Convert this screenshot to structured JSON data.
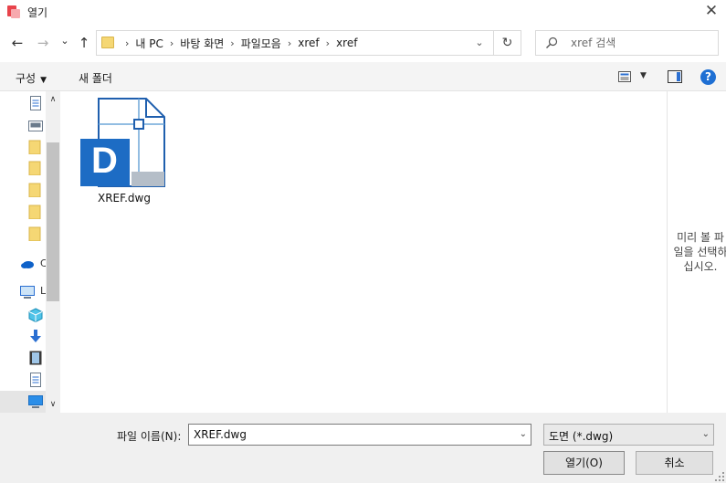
{
  "window": {
    "title": "열기",
    "close_glyph": "✕"
  },
  "nav": {
    "back_glyph": "←",
    "forward_glyph": "→",
    "recent_glyph": "⌄",
    "up_glyph": "↑",
    "breadcrumbs": [
      "내 PC",
      "바탕 화면",
      "파일모음",
      "xref",
      "xref"
    ],
    "crumb_separator": "›",
    "address_dropdown_glyph": "⌄",
    "refresh_glyph": "↻",
    "search_placeholder": "xref 검색"
  },
  "toolbar": {
    "organize_label": "구성",
    "organize_caret": "▼",
    "new_folder_label": "새 폴더",
    "view_caret": "▼",
    "help_glyph": "?"
  },
  "navpane": {
    "items": [
      {
        "icon": "document-icon"
      },
      {
        "icon": "image-icon"
      },
      {
        "icon": "folder-icon"
      },
      {
        "icon": "folder-icon"
      },
      {
        "icon": "folder-icon"
      },
      {
        "icon": "folder-icon"
      },
      {
        "icon": "folder-icon"
      },
      {
        "icon": "onedrive-icon",
        "label": "C"
      },
      {
        "icon": "computer-icon",
        "label": "L"
      },
      {
        "icon": "3d-objects-icon"
      },
      {
        "icon": "downloads-icon"
      },
      {
        "icon": "videos-icon"
      },
      {
        "icon": "documents-icon"
      },
      {
        "icon": "desktop-icon"
      }
    ],
    "scroll_up_glyph": "∧",
    "scroll_down_glyph": "∨"
  },
  "files": [
    {
      "name": "XREF.dwg",
      "badge_letter": "D",
      "icon": "dwg-file-icon"
    }
  ],
  "preview": {
    "message_lines": [
      "미리 볼 파",
      "일을 선택하",
      "십시오."
    ]
  },
  "bottom": {
    "filename_label": "파일 이름(N):",
    "filename_value": "XREF.dwg",
    "filename_caret": "⌄",
    "filetype_value": "도면 (*.dwg)",
    "filetype_caret": "⌄",
    "open_label": "열기(O)",
    "cancel_label": "취소"
  },
  "colors": {
    "accent": "#1e6fd3",
    "dwg_blue": "#1d6cc4",
    "folder_yellow": "#f5d774"
  }
}
